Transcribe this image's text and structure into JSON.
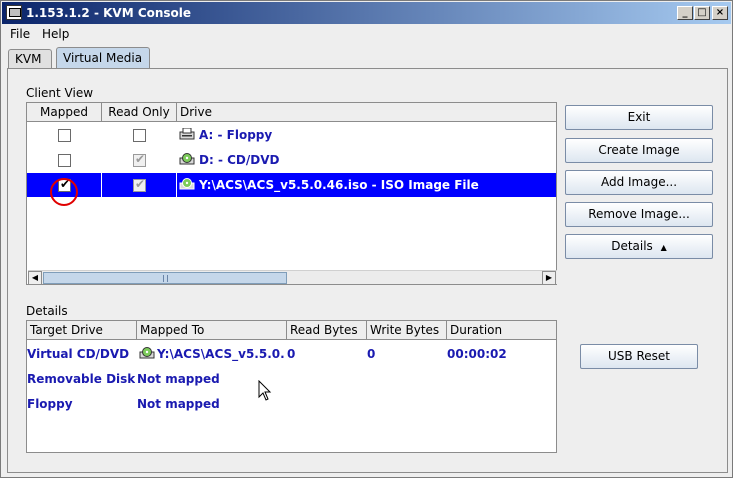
{
  "window": {
    "title": "1.153.1.2 - KVM Console"
  },
  "menu": [
    "File",
    "Help"
  ],
  "tabs": [
    {
      "label": "KVM",
      "active": false
    },
    {
      "label": "Virtual Media",
      "active": true
    }
  ],
  "client_view": {
    "label": "Client View",
    "columns": [
      "Mapped",
      "Read Only",
      "Drive"
    ],
    "rows": [
      {
        "mapped": false,
        "read_only": false,
        "read_only_disabled": false,
        "drive": "A: - Floppy",
        "icon": "floppy-drive-icon",
        "selected": false
      },
      {
        "mapped": false,
        "read_only": true,
        "read_only_disabled": true,
        "drive": "D: - CD/DVD",
        "icon": "cd-drive-icon",
        "selected": false
      },
      {
        "mapped": true,
        "read_only": true,
        "read_only_disabled": true,
        "drive": "Y:\\ACS\\ACS_v5.5.0.46.iso - ISO Image File",
        "icon": "cd-drive-icon",
        "selected": true,
        "highlighted": true
      }
    ]
  },
  "buttons": {
    "exit": "Exit",
    "create_image": "Create Image",
    "add_image": "Add Image...",
    "remove_image": "Remove Image...",
    "details": "Details",
    "usb_reset": "USB Reset"
  },
  "details": {
    "label": "Details",
    "columns": [
      "Target Drive",
      "Mapped To",
      "Read Bytes",
      "Write Bytes",
      "Duration"
    ],
    "rows": [
      {
        "target": "Virtual CD/DVD",
        "mapped_to": "Y:\\ACS\\ACS_v5.5.0.4...",
        "read_bytes": "0",
        "write_bytes": "0",
        "duration": "00:00:02",
        "icon": true
      },
      {
        "target": "Removable Disk",
        "mapped_to": "Not mapped",
        "read_bytes": "",
        "write_bytes": "",
        "duration": "",
        "icon": false
      },
      {
        "target": "Floppy",
        "mapped_to": "Not mapped",
        "read_bytes": "",
        "write_bytes": "",
        "duration": "",
        "icon": false
      }
    ]
  },
  "colors": {
    "selection": "#0000ff",
    "drive_text": "#1a1ab0",
    "highlight_circle": "#e00000"
  }
}
